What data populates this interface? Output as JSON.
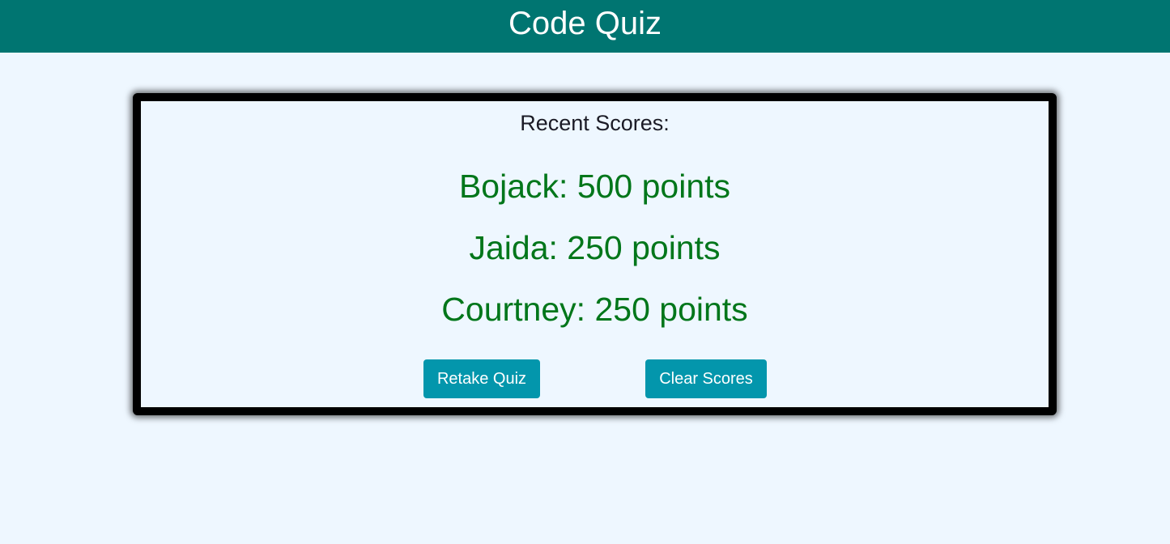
{
  "header": {
    "title": "Code Quiz"
  },
  "scores": {
    "heading": "Recent Scores:",
    "entries": [
      {
        "name": "Bojack",
        "points": "500 points"
      },
      {
        "name": "Jaida",
        "points": "250 points"
      },
      {
        "name": "Courtney",
        "points": "250 points"
      }
    ]
  },
  "actions": {
    "retake_label": "Retake Quiz",
    "clear_label": "Clear Scores"
  },
  "colors": {
    "header_bg": "#007571",
    "page_bg": "#eef7ff",
    "score_text": "#00761a",
    "button_bg": "#0396ac"
  }
}
